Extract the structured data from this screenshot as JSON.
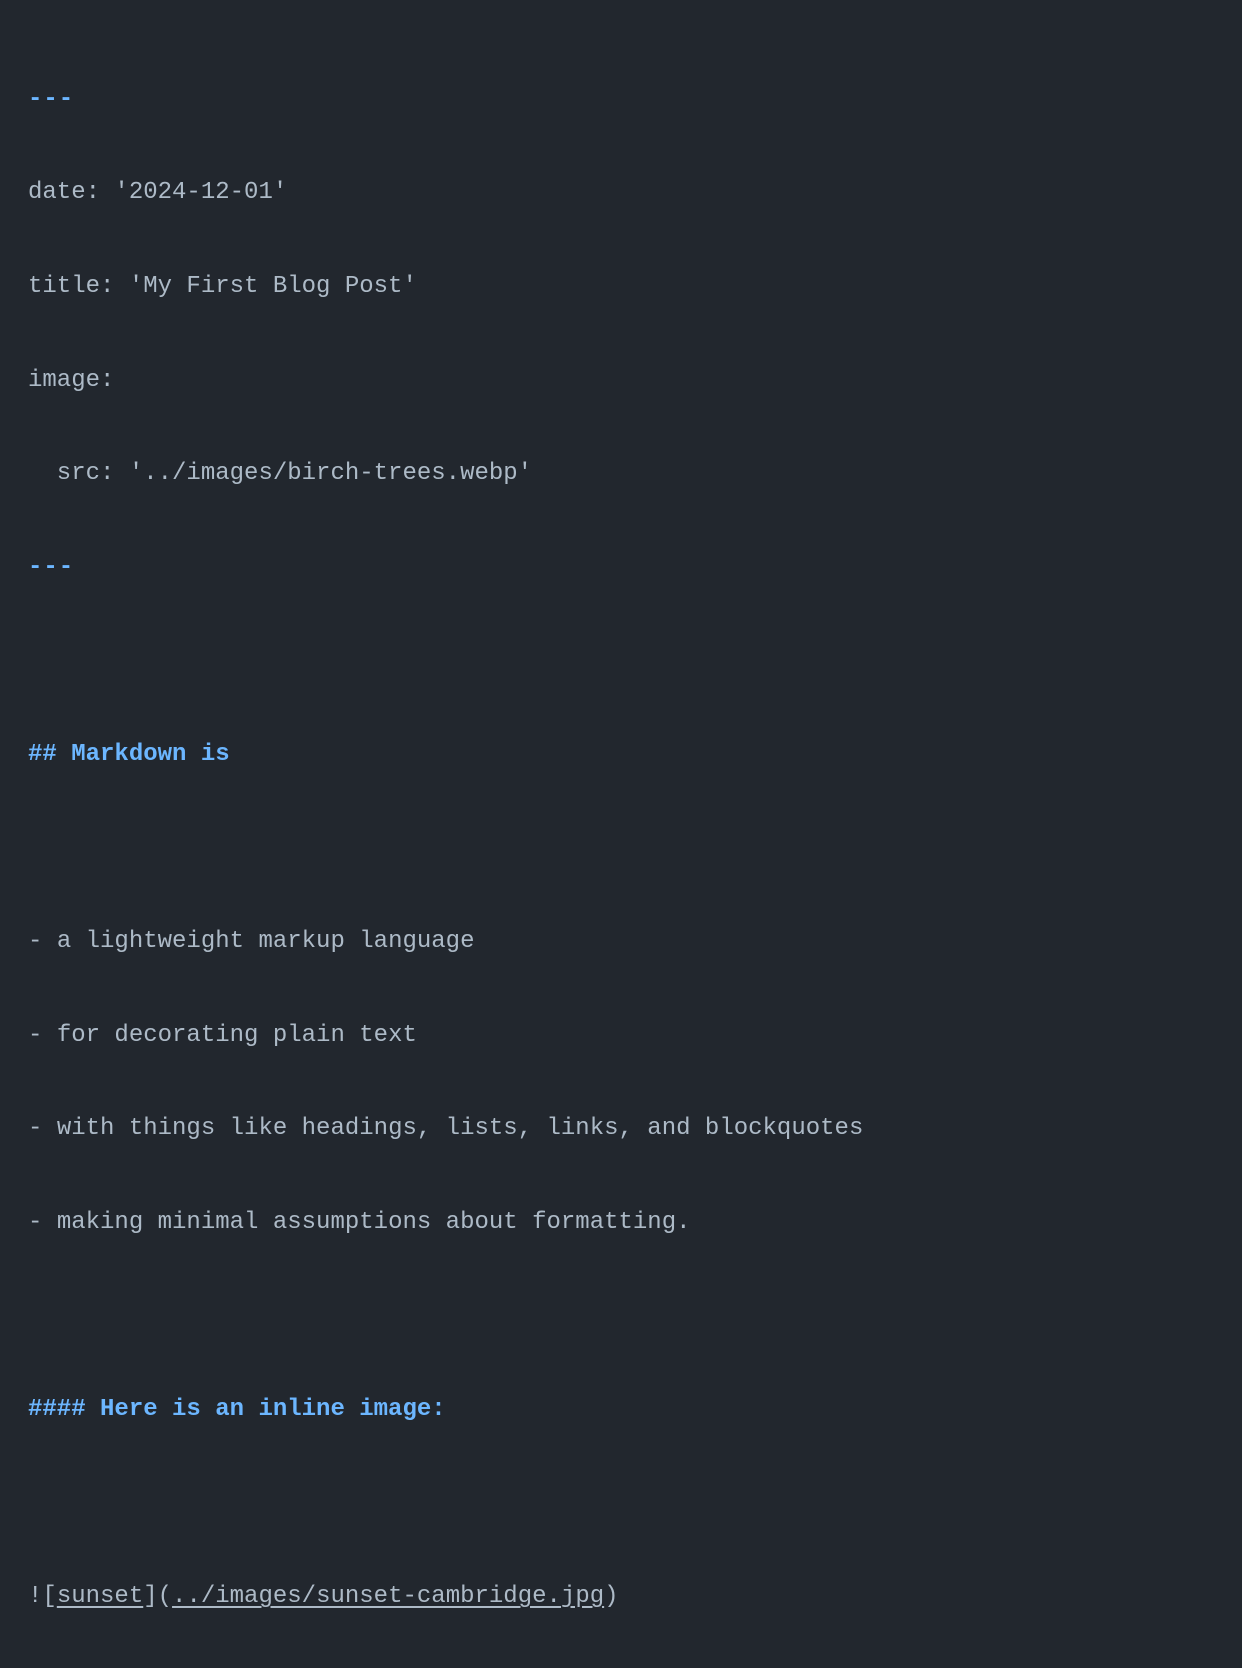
{
  "code": {
    "frontmatter": {
      "open": "---",
      "line1": "date: '2024-12-01'",
      "line2": "title: 'My First Blog Post'",
      "line3": "image:",
      "line4": "  src: '../images/birch-trees.webp'",
      "close": "---"
    },
    "heading1": "## Markdown is",
    "list": {
      "marker": "- ",
      "item1": "a lightweight markup language",
      "item2": "for decorating plain text",
      "item3": "with things like headings, lists, links, and blockquotes",
      "item4": "making minimal assumptions about formatting."
    },
    "heading2": "#### Here is an inline image:",
    "image_syntax": {
      "bang_bracket": "![",
      "alt_text": "sunset",
      "mid": "](",
      "url": "../images/sunset-cambridge.jpg",
      "close": ")"
    }
  }
}
